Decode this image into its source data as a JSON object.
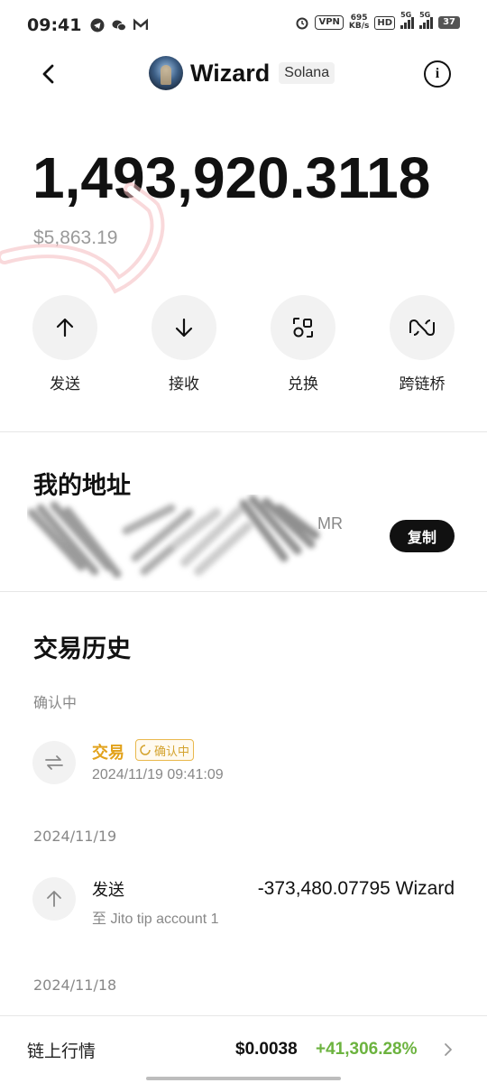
{
  "status_bar": {
    "time": "09:41",
    "vpn": "VPN",
    "speed_value": "695",
    "speed_unit": "KB/s",
    "hd": "HD",
    "net_1": "5G",
    "net_2": "5G",
    "battery": "37"
  },
  "header": {
    "token_name": "Wizard",
    "chain": "Solana"
  },
  "balance": {
    "amount": "1,493,920.3118",
    "fiat": "$5,863.19"
  },
  "actions": [
    {
      "label": "发送",
      "icon": "arrow-up-icon"
    },
    {
      "label": "接收",
      "icon": "arrow-down-icon"
    },
    {
      "label": "兑换",
      "icon": "swap-icon"
    },
    {
      "label": "跨链桥",
      "icon": "bridge-icon"
    }
  ],
  "address": {
    "title": "我的地址",
    "tail": "MR",
    "copy_label": "复制"
  },
  "history": {
    "title": "交易历史",
    "sections": [
      {
        "label": "确认中",
        "tx": {
          "type": "交易",
          "badge": "确认中",
          "time": "2024/11/19 09:41:09",
          "icon": "transfer-icon"
        }
      },
      {
        "label": "2024/11/19",
        "tx": {
          "type": "发送",
          "sub": "至 Jito tip account 1",
          "amount": "-373,480.07795 Wizard",
          "icon": "arrow-up-icon"
        }
      },
      {
        "label": "2024/11/18"
      }
    ]
  },
  "market": {
    "label": "链上行情",
    "price": "$0.0038",
    "change": "+41,306.28%"
  },
  "colors": {
    "pending": "#e2a21b",
    "positive": "#6cb33f",
    "muted": "#888888"
  }
}
